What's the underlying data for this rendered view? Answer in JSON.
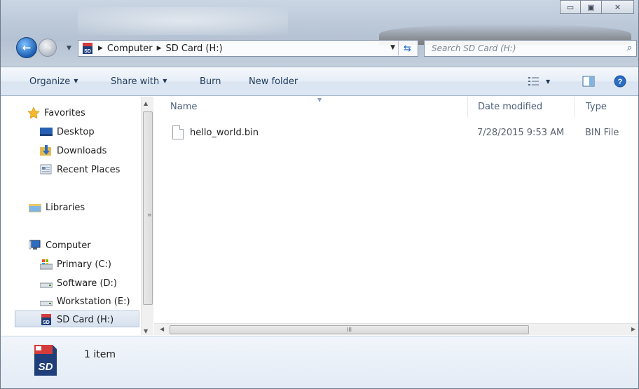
{
  "window": {
    "caption_buttons": {
      "minimize": "▭",
      "maximize": "▣",
      "close": "✕"
    }
  },
  "address_bar": {
    "crumbs": [
      "Computer",
      "SD Card (H:)"
    ],
    "search_placeholder": "Search SD Card (H:)"
  },
  "toolbar": {
    "organize": "Organize",
    "share_with": "Share with",
    "burn": "Burn",
    "new_folder": "New folder"
  },
  "nav_pane": {
    "favorites": "Favorites",
    "desktop": "Desktop",
    "downloads": "Downloads",
    "recent_places": "Recent Places",
    "libraries": "Libraries",
    "computer": "Computer",
    "primary": "Primary (C:)",
    "software": "Software (D:)",
    "workstation": "Workstation (E:)",
    "sd_card": "SD Card (H:)"
  },
  "columns": {
    "name": "Name",
    "date_modified": "Date modified",
    "type": "Type"
  },
  "files": [
    {
      "name": "hello_world.bin",
      "date": "7/28/2015 9:53 AM",
      "type": "BIN File"
    }
  ],
  "details": {
    "count": "1 item"
  },
  "icons": [
    "back-icon",
    "forward-icon",
    "sd-card-icon",
    "refresh-icon",
    "search-icon",
    "views-icon",
    "preview-pane-icon",
    "help-icon",
    "star-icon",
    "desktop-icon",
    "downloads-icon",
    "recent-places-icon",
    "libraries-icon",
    "computer-icon",
    "drive-icon",
    "file-icon"
  ]
}
